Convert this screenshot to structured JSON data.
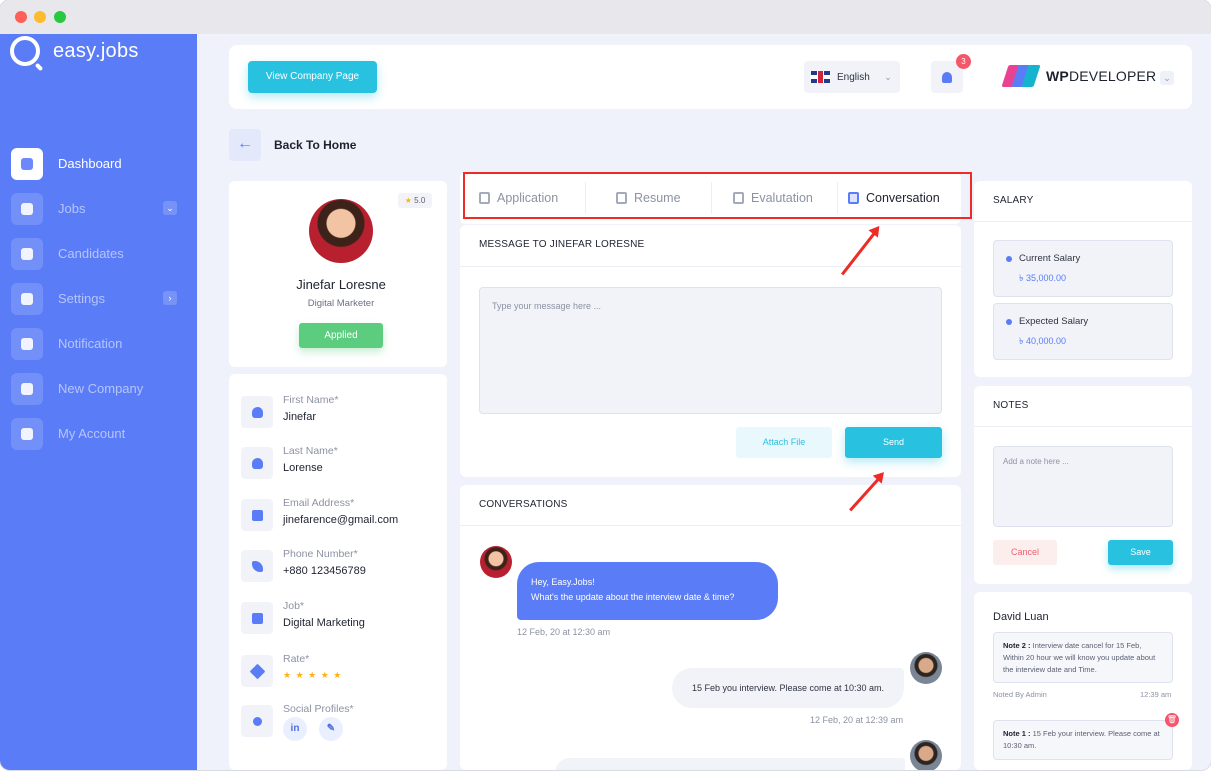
{
  "app": {
    "logo_text": "easy.jobs"
  },
  "sidebar": {
    "items": [
      {
        "label": "Dashboard",
        "icon": "home-icon"
      },
      {
        "label": "Jobs",
        "icon": "briefcase-icon"
      },
      {
        "label": "Candidates",
        "icon": "user-icon"
      },
      {
        "label": "Settings",
        "icon": "gear-icon"
      },
      {
        "label": "Notification",
        "icon": "bell-icon"
      },
      {
        "label": "New Company",
        "icon": "plus-icon"
      },
      {
        "label": "My Account",
        "icon": "user-icon"
      }
    ]
  },
  "header": {
    "company_button": "View Company Page",
    "language": "English",
    "notification_count": "3",
    "brand_bold": "WP",
    "brand_rest": "DEVELOPER"
  },
  "back": {
    "label": "Back To Home",
    "icon": "arrow-left-icon"
  },
  "profile": {
    "rating": "5.0",
    "name": "Jinefar Loresne",
    "role": "Digital Marketer",
    "status": "Applied"
  },
  "details": {
    "first_name_label": "First Name*",
    "first_name": "Jinefar",
    "last_name_label": "Last Name*",
    "last_name": "Lorense",
    "email_label": "Email Address*",
    "email": "jinefarence@gmail.com",
    "phone_label": "Phone Number*",
    "phone": "+880 123456789",
    "job_label": "Job*",
    "job": "Digital Marketing",
    "rate_label": "Rate*",
    "rate_stars": "★ ★ ★ ★ ★",
    "social_label": "Social Profiles*",
    "social_linkedin": "in"
  },
  "tabs": [
    {
      "label": "Application"
    },
    {
      "label": "Resume"
    },
    {
      "label": "Evalutation"
    },
    {
      "label": "Conversation"
    }
  ],
  "message": {
    "title": "MESSAGE TO JINEFAR LORESNE",
    "placeholder": "Type your message here ...",
    "attach_label": "Attach File",
    "send_label": "Send"
  },
  "conversations": {
    "title": "CONVERSATIONS",
    "messages": [
      {
        "line1": "Hey, Easy.Jobs!",
        "line2": "What's the update about the interview date & time?",
        "time": "12 Feb, 20 at 12:30 am"
      },
      {
        "text": "15 Feb you interview. Please come at 10:30 am.",
        "time": "12 Feb, 20 at 12:39 am"
      }
    ]
  },
  "salary": {
    "title": "SALARY",
    "current_label": "Current Salary",
    "current_value": "৳ 35,000.00",
    "expected_label": "Expected Salary",
    "expected_value": "৳ 40,000.00"
  },
  "notes": {
    "title": "NOTES",
    "placeholder": "Add a note here ...",
    "cancel_label": "Cancel",
    "save_label": "Save"
  },
  "notes_list": {
    "author": "David Luan",
    "note2_title": "Note 2 :",
    "note2_text": "Interview date cancel for 15 Feb, Within 20 hour we will know you update about the interview date and Time.",
    "note2_by": "Noted By Admin",
    "note2_time": "12:39 am",
    "note1_title": "Note 1 :",
    "note1_text": "15 Feb your interview. Please come at 10:30 am."
  },
  "colors": {
    "primary": "#5b7cf7",
    "accent": "#29c1e0",
    "success": "#5ccd7f",
    "danger": "#f4566a",
    "highlight": "#ee2b24"
  }
}
